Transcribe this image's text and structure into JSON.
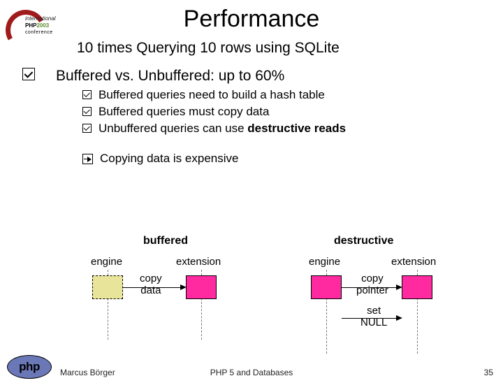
{
  "title": "Performance",
  "subtitle": "10 times Querying 10 rows using SQLite",
  "main_bullet": "Buffered vs. Unbuffered: up to 60%",
  "sub_bullets": [
    "Buffered queries need to build a hash table",
    "Buffered queries must copy data",
    "Unbuffered queries can use "
  ],
  "sub_bullet_2_strong": "destructive reads",
  "arrow_bullet": "Copying data is expensive",
  "diagram": {
    "left_heading": "buffered",
    "right_heading": "destructive",
    "engine_label": "engine",
    "extension_label": "extension",
    "copy_data": "copy\ndata",
    "copy_pointer": "copy\npointer",
    "set_null": "set\nNULL"
  },
  "logo_top": {
    "line1": "international",
    "line2a": "PHP",
    "line2b": "2003",
    "line3": "conference"
  },
  "footer": {
    "author": "Marcus Börger",
    "center": "PHP 5 and Databases",
    "page": "35"
  },
  "php_logo_text": "php"
}
